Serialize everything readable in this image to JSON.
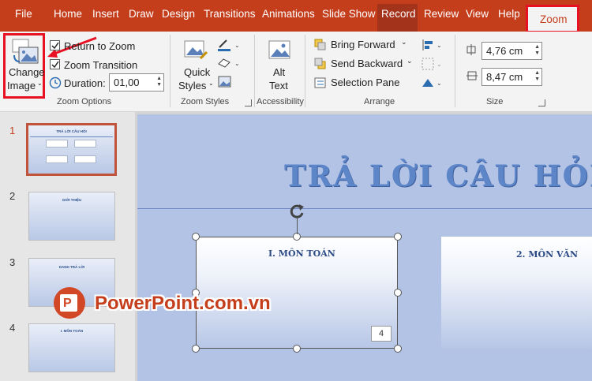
{
  "tabs": {
    "file": "File",
    "home": "Home",
    "insert": "Insert",
    "draw": "Draw",
    "design": "Design",
    "transitions": "Transitions",
    "animations": "Animations",
    "slideshow": "Slide Show",
    "record": "Record",
    "review": "Review",
    "view": "View",
    "help": "Help",
    "zoom": "Zoom"
  },
  "ribbon": {
    "zoom_options": {
      "change_image": "Change",
      "change_image_2": "Image",
      "return_to_zoom": "Return to Zoom",
      "zoom_transition": "Zoom Transition",
      "duration_label": "Duration:",
      "duration_value": "01,00",
      "group_label": "Zoom Options"
    },
    "zoom_styles": {
      "quick_styles": "Quick",
      "quick_styles_2": "Styles",
      "group_label": "Zoom Styles"
    },
    "accessibility": {
      "alt_text": "Alt",
      "alt_text_2": "Text",
      "group_label": "Accessibility"
    },
    "arrange": {
      "bring_forward": "Bring Forward",
      "send_backward": "Send Backward",
      "selection_pane": "Selection Pane",
      "group_label": "Arrange"
    },
    "size": {
      "height": "4,76 cm",
      "width": "8,47 cm",
      "group_label": "Size"
    }
  },
  "thumbnails": [
    {
      "num": "1",
      "title": "TRẢ LỜI CÂU HỎI",
      "selected": true
    },
    {
      "num": "2",
      "title": "GIỚI THIỆU"
    },
    {
      "num": "3",
      "title": "DANH TRẢ LỜI"
    },
    {
      "num": "4",
      "title": "I. MÔN TOÁN"
    }
  ],
  "slide": {
    "title": "TRẢ LỜI CÂU HỎI",
    "zoom1_label": "I. MÔN TOÁN",
    "zoom2_label": "2. MÔN VĂN",
    "zoom1_number": "4"
  },
  "watermark": "PowerPoint.com.vn",
  "colors": {
    "accent": "#c43e1c",
    "highlight": "#e81123"
  }
}
